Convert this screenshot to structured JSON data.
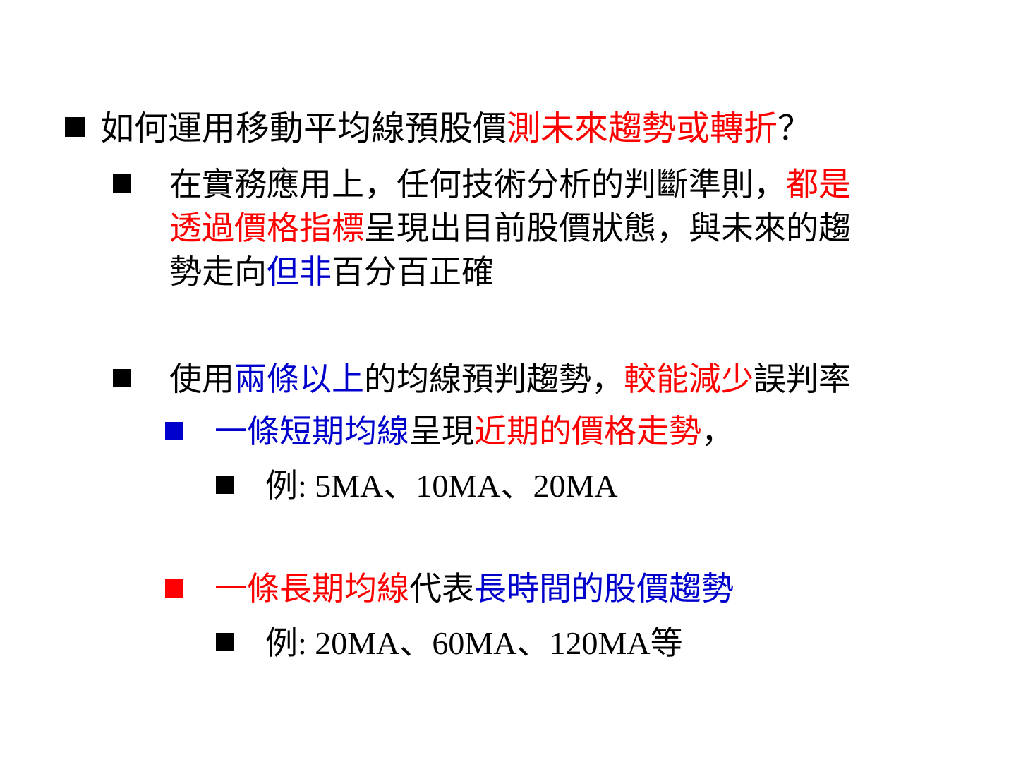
{
  "slide": {
    "heading": {
      "part1": "如何運用移動平均線預股價",
      "part2": "測未來趨勢或轉折",
      "part3": "？"
    },
    "point1": {
      "line1_black": "在實務應用上，任何技術分析的判斷準則，",
      "line1_red": "都是",
      "line2_red": "透過價格指標",
      "line2_black": "呈現出目前股價狀態，與未來的趨",
      "line3_black1": "勢走向",
      "line3_blue": "但非",
      "line3_black2": "百分百正確"
    },
    "point2": {
      "black1": "使用",
      "blue": "兩條以上",
      "black2": "的均線預判趨勢，",
      "red": "較能減少",
      "black3": "誤判率"
    },
    "short_ma": {
      "blue": "一條短期均線",
      "black1": "呈現",
      "red": "近期的價格走勢",
      "black2": "，"
    },
    "short_example": {
      "prefix": "例",
      "text": ": 5MA、10MA、20MA"
    },
    "long_ma": {
      "red": "一條長期均線",
      "black": "代表",
      "blue": "長時間的股價趨勢"
    },
    "long_example": {
      "prefix": "例",
      "text": ": 20MA、60MA、120MA",
      "suffix": "等"
    },
    "colors": {
      "red": "#ff0000",
      "blue": "#0000cc",
      "black": "#000000"
    }
  }
}
